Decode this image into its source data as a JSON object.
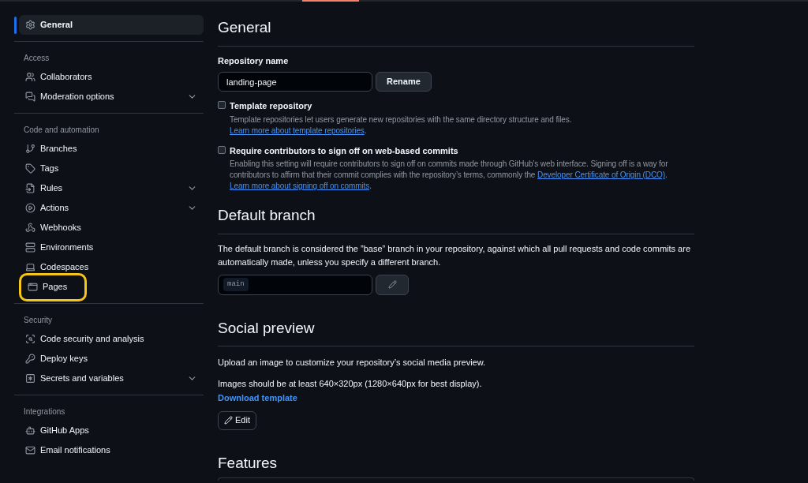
{
  "sidebar": {
    "groups": [
      {
        "items": [
          {
            "label": "General",
            "selected": true,
            "has_submenu": false,
            "highlighted": false
          }
        ]
      },
      {
        "heading": "Access",
        "items": [
          {
            "label": "Collaborators",
            "selected": false,
            "has_submenu": false,
            "highlighted": false
          },
          {
            "label": "Moderation options",
            "selected": false,
            "has_submenu": true,
            "highlighted": false
          }
        ]
      },
      {
        "heading": "Code and automation",
        "items": [
          {
            "label": "Branches",
            "selected": false,
            "has_submenu": false,
            "highlighted": false
          },
          {
            "label": "Tags",
            "selected": false,
            "has_submenu": false,
            "highlighted": false
          },
          {
            "label": "Rules",
            "selected": false,
            "has_submenu": true,
            "highlighted": false
          },
          {
            "label": "Actions",
            "selected": false,
            "has_submenu": true,
            "highlighted": false
          },
          {
            "label": "Webhooks",
            "selected": false,
            "has_submenu": false,
            "highlighted": false
          },
          {
            "label": "Environments",
            "selected": false,
            "has_submenu": false,
            "highlighted": false
          },
          {
            "label": "Codespaces",
            "selected": false,
            "has_submenu": false,
            "highlighted": false
          },
          {
            "label": "Pages",
            "selected": false,
            "has_submenu": false,
            "highlighted": true
          }
        ]
      },
      {
        "heading": "Security",
        "items": [
          {
            "label": "Code security and analysis",
            "selected": false,
            "has_submenu": false,
            "highlighted": false
          },
          {
            "label": "Deploy keys",
            "selected": false,
            "has_submenu": false,
            "highlighted": false
          },
          {
            "label": "Secrets and variables",
            "selected": false,
            "has_submenu": true,
            "highlighted": false
          }
        ]
      },
      {
        "heading": "Integrations",
        "items": [
          {
            "label": "GitHub Apps",
            "selected": false,
            "has_submenu": false,
            "highlighted": false
          },
          {
            "label": "Email notifications",
            "selected": false,
            "has_submenu": false,
            "highlighted": false
          }
        ]
      }
    ]
  },
  "general": {
    "title": "General",
    "repository_name": {
      "label": "Repository name",
      "value": "landing-page",
      "button": "Rename"
    },
    "options": [
      {
        "label": "Template repository",
        "checked": false,
        "description": [
          {
            "kind": "text",
            "text": "Template repositories let users generate new repositories with the same directory structure and files. "
          },
          {
            "kind": "link",
            "text": "Learn more about template repositories"
          },
          {
            "kind": "text",
            "text": "."
          }
        ]
      },
      {
        "label": "Require contributors to sign off on web-based commits",
        "checked": false,
        "description": [
          {
            "kind": "text",
            "text": "Enabling this setting will require contributors to sign off on commits made through GitHub’s web interface. Signing off is a way for contributors to affirm that their commit complies with the repository’s terms, commonly the "
          },
          {
            "kind": "link",
            "text": "Developer Certificate of Origin (DCO)"
          },
          {
            "kind": "text",
            "text": ". "
          },
          {
            "kind": "link",
            "text": "Learn more about signing off on commits"
          },
          {
            "kind": "text",
            "text": "."
          }
        ]
      }
    ]
  },
  "default_branch": {
    "title": "Default branch",
    "description": "The default branch is considered the ”base” branch in your repository, against which all pull requests and code commits are automatically made, unless you specify a different branch.",
    "branch": "main"
  },
  "social_preview": {
    "title": "Social preview",
    "description": "Upload an image to customize your repository’s social media preview.",
    "size_note": "Images should be at least 640×320px (1280×640px for best display).",
    "download_link": "Download template",
    "edit_button": "Edit"
  },
  "features": {
    "title": "Features"
  }
}
